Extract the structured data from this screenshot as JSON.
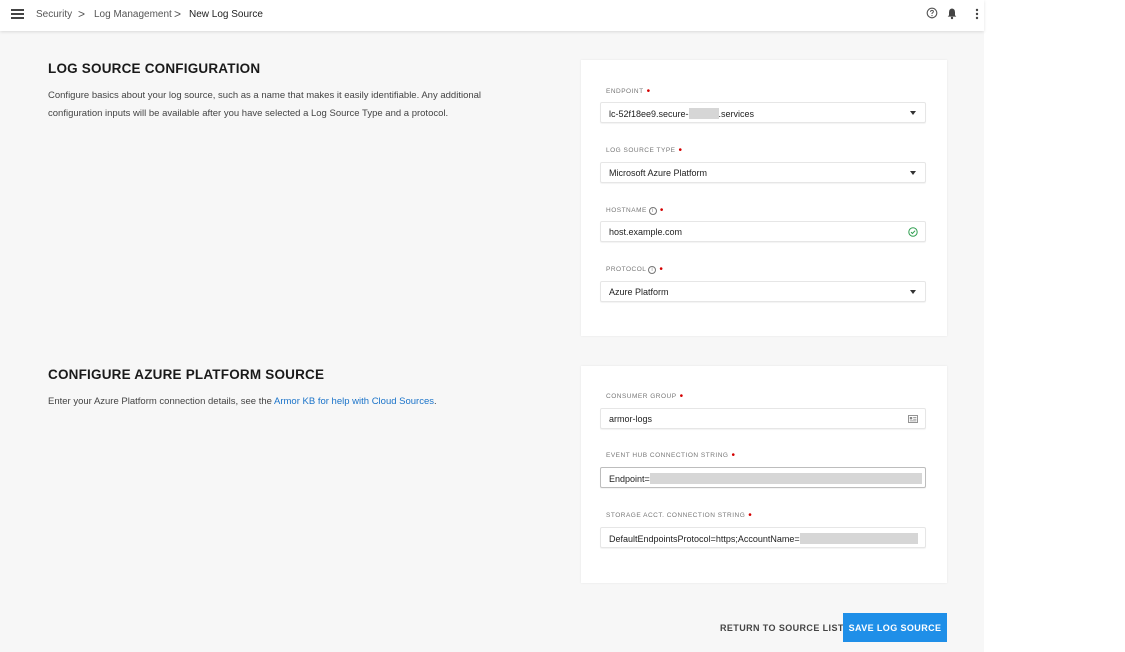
{
  "breadcrumb": {
    "items": [
      "Security",
      "Log Management",
      "New Log Source"
    ],
    "separator": ">"
  },
  "section1": {
    "title": "LOG SOURCE CONFIGURATION",
    "desc_line1": "Configure basics about your log source, such as a name that makes it easily identifiable. Any additional",
    "desc_line2": "configuration inputs will be available after you have selected a Log Source Type and a protocol."
  },
  "section2": {
    "title": "CONFIGURE AZURE PLATFORM SOURCE",
    "desc_prefix": "Enter your Azure Platform connection details, see the ",
    "desc_link": "Armor KB for help with Cloud Sources",
    "desc_suffix": "."
  },
  "fields": {
    "endpoint": {
      "label": "ENDPOINT",
      "value_prefix": "lc-52f18ee9.secure-",
      "value_suffix": ".services"
    },
    "log_source_type": {
      "label": "LOG SOURCE TYPE",
      "value": "Microsoft Azure Platform"
    },
    "hostname": {
      "label": "HOSTNAME",
      "value": "host.example.com"
    },
    "protocol": {
      "label": "PROTOCOL",
      "value": "Azure Platform"
    },
    "consumer_group": {
      "label": "CONSUMER GROUP",
      "value": "armor-logs"
    },
    "event_hub": {
      "label": "EVENT HUB CONNECTION STRING",
      "value": "Endpoint="
    },
    "storage_acct": {
      "label": "STORAGE ACCT. CONNECTION STRING",
      "value": "DefaultEndpointsProtocol=https;AccountName="
    }
  },
  "required_mark": "•",
  "info_mark": "i",
  "buttons": {
    "return": "RETURN TO SOURCE LIST",
    "save": "SAVE LOG SOURCE"
  },
  "icons": {
    "menu": "hamburger-icon",
    "help": "help-circle-icon",
    "notifications": "bell-icon",
    "more": "more-vertical-icon",
    "dropdown": "chevron-down-icon",
    "valid": "check-circle-icon",
    "card": "id-card-icon"
  },
  "colors": {
    "primary": "#1f8fe8",
    "required": "#d40000",
    "valid": "#2e9e4f",
    "link": "#1a73c9"
  }
}
